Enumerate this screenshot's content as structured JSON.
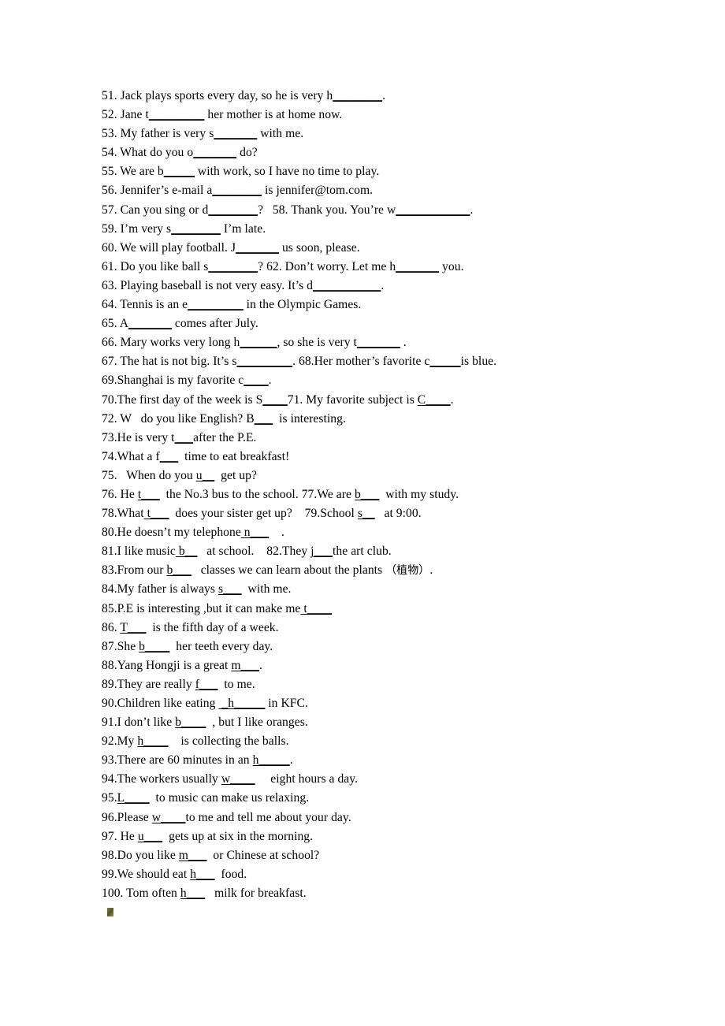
{
  "document": {
    "type": "worksheet",
    "subject": "English fill-in-the-blank exercise",
    "page_background": "#ffffff",
    "text_color": "#000000",
    "artifact_color": "#6b6b35",
    "artifact_name": "broken-image-placeholder"
  },
  "lines": [
    {
      "id": 51,
      "text": "51. Jack plays sports every day, so he is very h",
      "blank": "________",
      "tail": "."
    },
    {
      "id": 52,
      "text": "52. Jane t",
      "blank": "_________",
      "tail": " her mother is at home now."
    },
    {
      "id": 53,
      "text": "53. My father is very s",
      "blank": "_______",
      "tail": " with me."
    },
    {
      "id": 54,
      "text": "54. What do you o",
      "blank": "_______",
      "tail": " do?"
    },
    {
      "id": 55,
      "text": "55. We are b",
      "blank": "_____",
      "tail": " with work, so I have no time to play."
    },
    {
      "id": 56,
      "text": "56. Jennifer’s e-mail a",
      "blank": "________",
      "tail": " is jennifer@tom.com."
    },
    {
      "id": 57,
      "text": "57. Can you sing or d",
      "blank": "________",
      "tail": "?   58. Thank you. You’re w",
      "blank2": "____________",
      "tail2": "."
    },
    {
      "id": 59,
      "text": "59. I’m very s",
      "blank": "________",
      "tail": " I’m late."
    },
    {
      "id": 60,
      "text": "60. We will play football. J",
      "blank": "_______",
      "tail": " us soon, please."
    },
    {
      "id": 61,
      "text": "61. Do you like ball s",
      "blank": "________",
      "tail": "? 62. Don’t worry. Let me h",
      "blank2": "_______",
      "tail2": " you."
    },
    {
      "id": 63,
      "text": "63. Playing baseball is not very easy. It’s d",
      "blank": "___________",
      "tail": "."
    },
    {
      "id": 64,
      "text": "64. Tennis is an e",
      "blank": "_________",
      "tail": " in the Olympic Games."
    },
    {
      "id": 65,
      "text": "65. A",
      "blank": "_______",
      "tail": " comes after July."
    },
    {
      "id": 66,
      "text": "66. Mary works very long h",
      "blank": "______",
      "tail": ", so she is very t",
      "blank2": "_______",
      "tail2": " ."
    },
    {
      "id": 67,
      "text": "67. The hat is not big. It’s s",
      "blank": "_________",
      "tail": ". 68.Her mother’s favorite c",
      "blank2": "_____",
      "tail2": "is blue."
    },
    {
      "id": 69,
      "text": "69.Shanghai is my favorite c",
      "blank": "____",
      "tail": "."
    },
    {
      "id": 70,
      "text": "70.The first day of the week is S",
      "blank": "____",
      "tail": "71. My favorite subject is ",
      "blank2": "C____",
      "tail2": "."
    },
    {
      "id": 72,
      "text": "72. W   do you like English? B",
      "blank": "___",
      "tail": "  is interesting."
    },
    {
      "id": 73,
      "text": "73.He is very t",
      "blank": "___",
      "tail": "after the P.E."
    },
    {
      "id": 74,
      "text": "74.What a f",
      "blank": "___",
      "tail": "  time to eat breakfast!"
    },
    {
      "id": 75,
      "text": "75.   When do you ",
      "blank": "u__",
      "tail": "  get up?"
    },
    {
      "id": 76,
      "text": "76. He ",
      "blank": "t___",
      "tail": "  the No.3 bus to the school. 77.We are ",
      "blank2": "b___",
      "tail2": "  with my study."
    },
    {
      "id": 78,
      "text": "78.What",
      "blank": " t___",
      "tail": "  does your sister get up?    79.School ",
      "blank2": "s__",
      "tail2": "   at 9:00."
    },
    {
      "id": 80,
      "text": "80.He doesn’t my telephone",
      "blank": " n___",
      "tail": "    ."
    },
    {
      "id": 81,
      "text": "81.I like music",
      "blank": " b__",
      "tail": "   at school.    82.They ",
      "blank2": "j___",
      "tail2": "the art club."
    },
    {
      "id": 83,
      "text": "83.From our ",
      "blank": "b___",
      "tail": "   classes we can learn about the plants ",
      "cjk": "（植物）",
      "tail2": "."
    },
    {
      "id": 84,
      "text": "84.My father is always ",
      "blank": "s___",
      "tail": "  with me."
    },
    {
      "id": 85,
      "text": "85.P.E is interesting ,but it can make me",
      "blank": " t____",
      "tail": ""
    },
    {
      "id": 86,
      "text": "86. ",
      "blank": "T___",
      "tail": "  is the fifth day of a week."
    },
    {
      "id": 87,
      "text": "87.She ",
      "blank": "b____",
      "tail": "  her teeth every day."
    },
    {
      "id": 88,
      "text": "88.Yang Hongji is a great ",
      "blank": "m___",
      "tail": "."
    },
    {
      "id": 89,
      "text": "89.They are really ",
      "blank": "f___",
      "tail": "  to me."
    },
    {
      "id": 90,
      "text": "90.Children like eating ",
      "blank": " _h_____",
      "tail": " in KFC."
    },
    {
      "id": 91,
      "text": "91.I don’t like ",
      "blank": "b____",
      "tail": "  , but I like oranges."
    },
    {
      "id": 92,
      "text": "92.My ",
      "blank": "h____",
      "tail": "    is collecting the balls."
    },
    {
      "id": 93,
      "text": "93.There are 60 minutes in an ",
      "blank": "h_____",
      "tail": "."
    },
    {
      "id": 94,
      "text": "94.The workers usually ",
      "blank": "w____",
      "tail": "     eight hours a day."
    },
    {
      "id": 95,
      "text": "95.",
      "blank": "L____",
      "tail": "  to music can make us relaxing."
    },
    {
      "id": 96,
      "text": "96.Please ",
      "blank": "w____",
      "tail": "to me and tell me about your day."
    },
    {
      "id": 97,
      "text": "97. He ",
      "blank": "u___",
      "tail": "  gets up at six in the morning."
    },
    {
      "id": 98,
      "text": "98.Do you like ",
      "blank": "m___",
      "tail": "  or Chinese at school?"
    },
    {
      "id": 99,
      "text": "99.We should eat ",
      "blank": "h___",
      "tail": "  food."
    },
    {
      "id": 100,
      "text": "100. Tom often ",
      "blank": "h___",
      "tail": "   milk for breakfast."
    }
  ]
}
